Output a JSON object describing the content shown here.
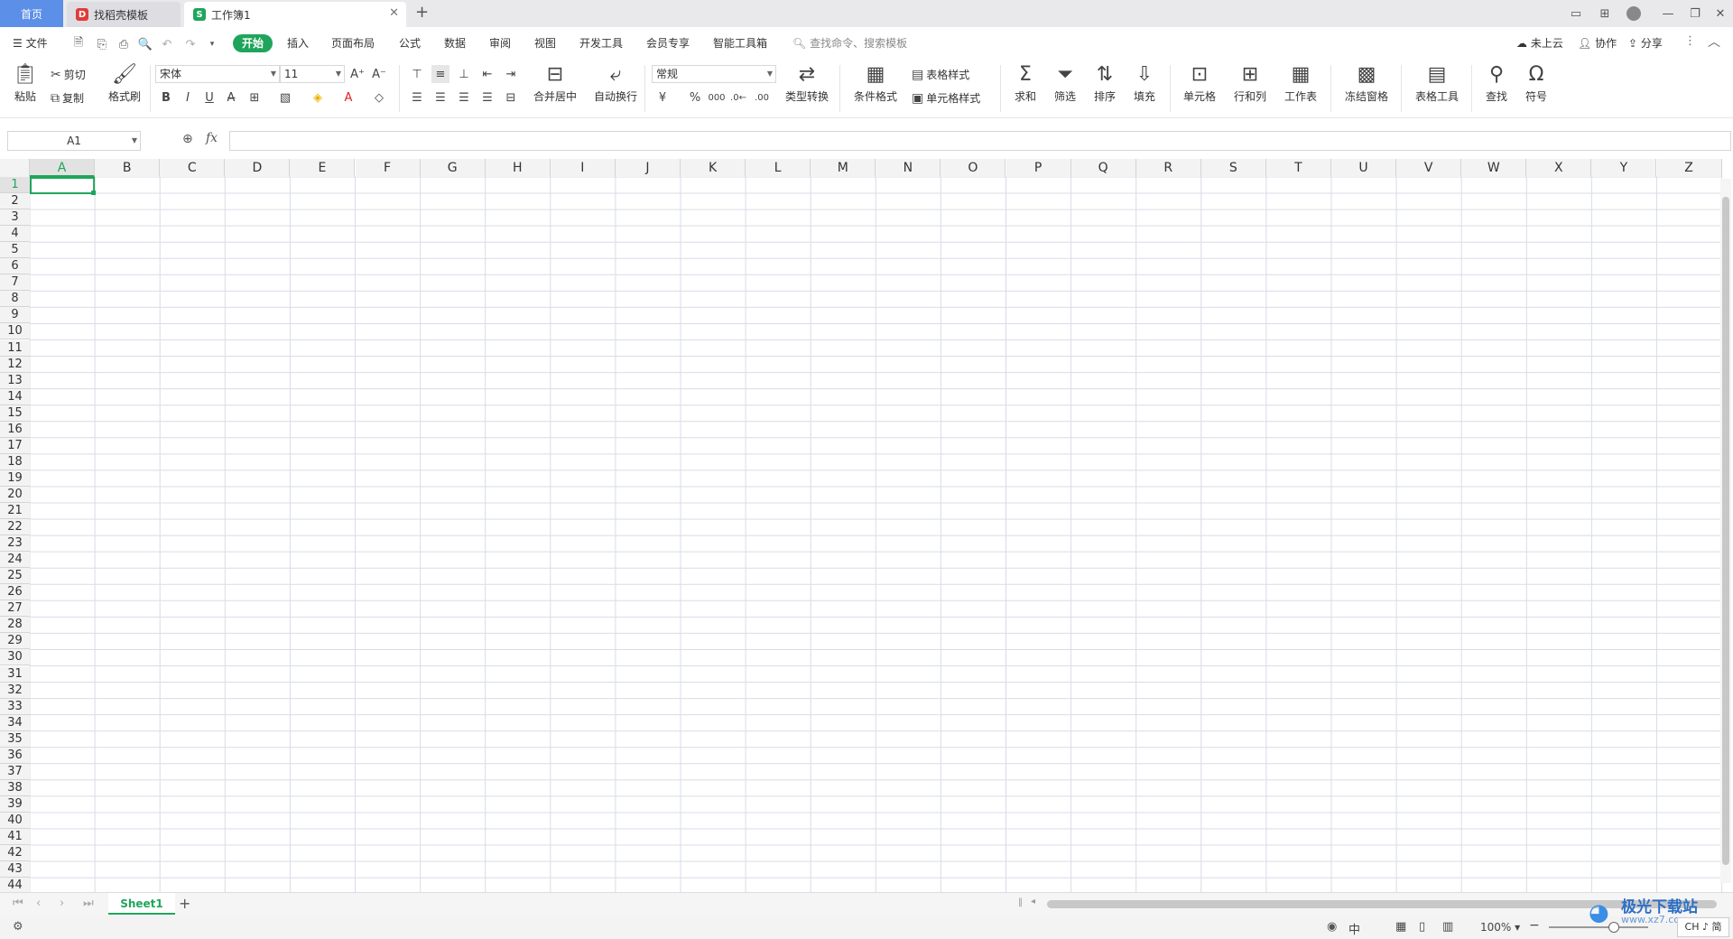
{
  "titlebar": {
    "tabs": [
      {
        "label": "首页"
      },
      {
        "label": "找稻壳模板"
      },
      {
        "label": "工作簿1"
      }
    ],
    "new_tab": "+"
  },
  "menubar": {
    "file_label": "文件",
    "items": [
      "开始",
      "插入",
      "页面布局",
      "公式",
      "数据",
      "审阅",
      "视图",
      "开发工具",
      "会员专享",
      "智能工具箱"
    ],
    "search_placeholder": "查找命令、搜索模板",
    "cloud_label": "未上云",
    "collab_label": "协作",
    "share_label": "分享"
  },
  "ribbon": {
    "paste": "粘贴",
    "cut": "剪切",
    "copy": "复制",
    "format_painter": "格式刷",
    "font_name": "宋体",
    "font_size": "11",
    "merge_center": "合并居中",
    "wrap_text": "自动换行",
    "number_format": "常规",
    "type_convert": "类型转换",
    "cond_format": "条件格式",
    "table_style": "表格样式",
    "cell_style": "单元格样式",
    "sum": "求和",
    "filter": "筛选",
    "sort": "排序",
    "fill": "填充",
    "cell": "单元格",
    "row_col": "行和列",
    "worksheet": "工作表",
    "freeze": "冻结窗格",
    "table_tools": "表格工具",
    "find": "查找",
    "symbol": "符号"
  },
  "formula_bar": {
    "name_box": "A1",
    "fx": "fx",
    "value": ""
  },
  "grid": {
    "columns": [
      "A",
      "B",
      "C",
      "D",
      "E",
      "F",
      "G",
      "H",
      "I",
      "J",
      "K",
      "L",
      "M",
      "N",
      "O",
      "P",
      "Q",
      "R",
      "S",
      "T",
      "U",
      "V",
      "W",
      "X",
      "Y",
      "Z"
    ],
    "row_count": 44,
    "selected_cell": "A1"
  },
  "sheets": {
    "tabs": [
      "Sheet1"
    ],
    "add": "+"
  },
  "statusbar": {
    "ime": "中",
    "zoom": "100%",
    "watermark": "极光下载站",
    "watermark_url": "www.xz7.com",
    "ime_badge": "CH ♪ 简"
  },
  "colors": {
    "accent": "#1fa55b",
    "home_tab": "#5b8fe8",
    "grid_line": "#d9dce8"
  }
}
